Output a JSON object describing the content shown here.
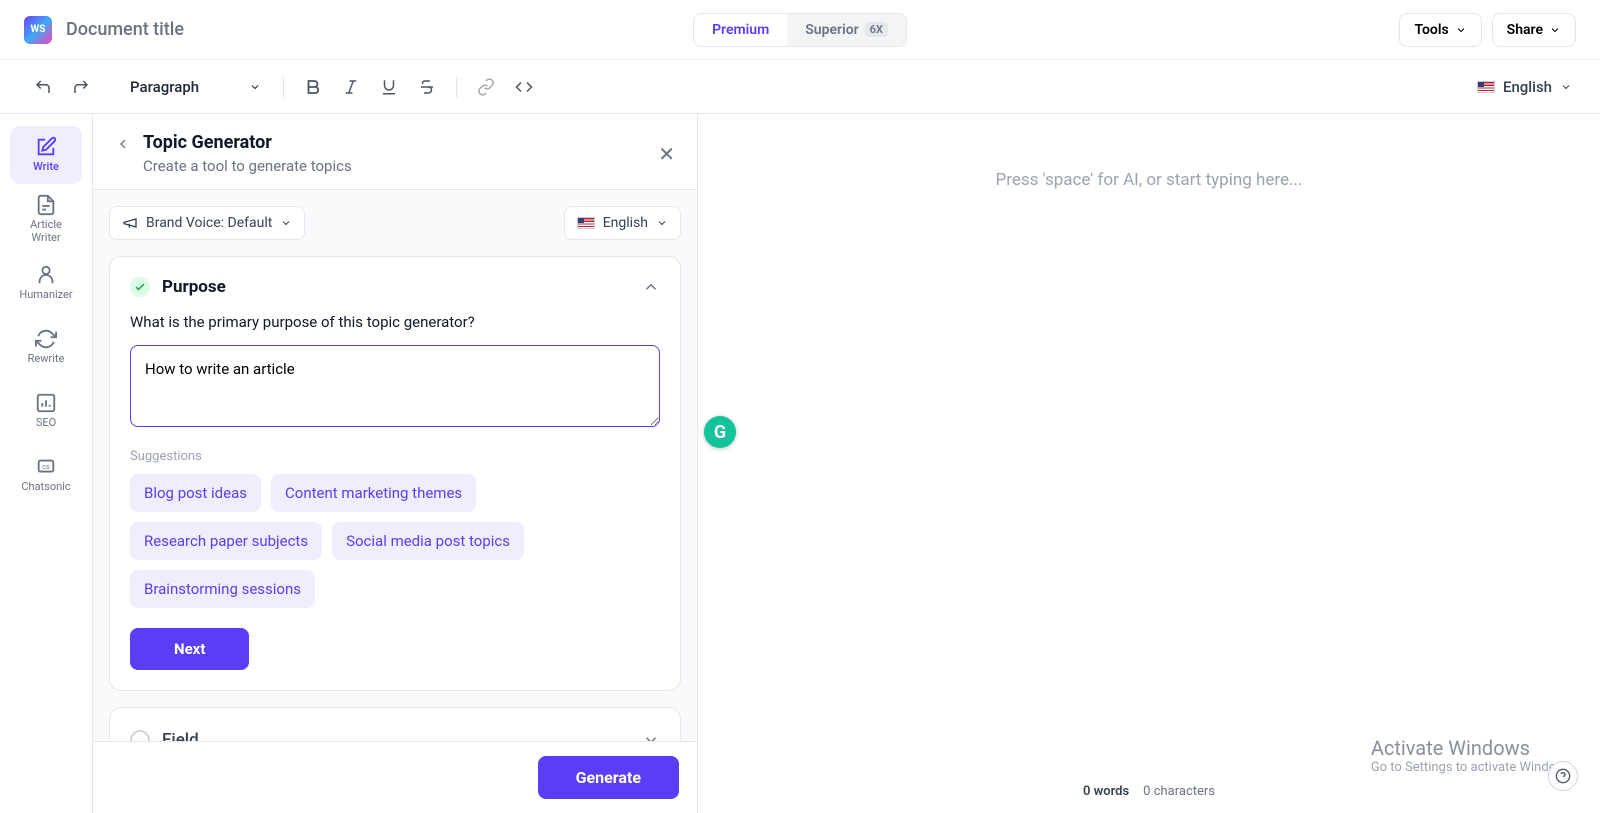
{
  "header": {
    "logo_text": "WS",
    "doc_title_placeholder": "Document title",
    "plan": {
      "premium": "Premium",
      "superior": "Superior",
      "superior_badge": "6X"
    },
    "tools": "Tools",
    "share": "Share"
  },
  "toolbar": {
    "block_type": "Paragraph",
    "language": "English"
  },
  "sidebar": {
    "items": [
      {
        "label": "Write"
      },
      {
        "label": "Article\nWriter"
      },
      {
        "label": "Humanizer"
      },
      {
        "label": "Rewrite"
      },
      {
        "label": "SEO"
      },
      {
        "label": "Chatsonic"
      }
    ]
  },
  "panel": {
    "title": "Topic Generator",
    "subtitle": "Create a tool to generate topics",
    "brand_voice": "Brand Voice: Default",
    "language": "English",
    "purpose": {
      "title": "Purpose",
      "question": "What is the primary purpose of this topic generator?",
      "value": "How to write an article",
      "suggestions_label": "Suggestions",
      "suggestions": [
        "Blog post ideas",
        "Content marketing themes",
        "Research paper subjects",
        "Social media post topics",
        "Brainstorming sessions"
      ],
      "next": "Next"
    },
    "field": {
      "title": "Field"
    },
    "generate": "Generate"
  },
  "editor": {
    "placeholder": "Press 'space' for AI, or start typing here...",
    "status": {
      "words": "0 words",
      "chars": "0 characters"
    }
  },
  "overlay": {
    "activate_title": "Activate Windows",
    "activate_sub": "Go to Settings to activate Windows."
  }
}
